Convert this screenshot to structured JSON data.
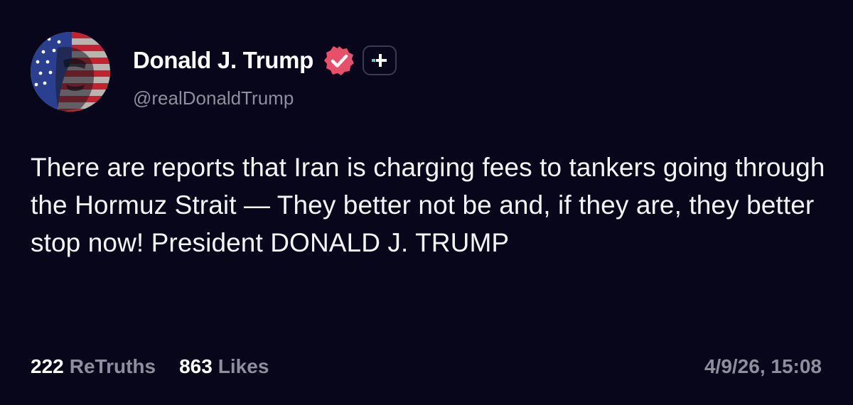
{
  "post": {
    "author": {
      "display_name": "Donald J. Trump",
      "handle": "@realDonaldTrump",
      "verified_icon": "verified-badge-icon",
      "plus_icon": "plus-badge-icon"
    },
    "text": "There are reports that Iran is charging fees to tankers going through the Hormuz Strait — They better not be and, if they are, they better stop now! President DONALD J. TRUMP",
    "stats": {
      "retruths_count": "222",
      "retruths_label": "ReTruths",
      "likes_count": "863",
      "likes_label": "Likes"
    },
    "timestamp": "4/9/26, 15:08"
  },
  "colors": {
    "background": "#07061a",
    "verified": "#e8506a",
    "muted_text": "#8e8e9c"
  }
}
